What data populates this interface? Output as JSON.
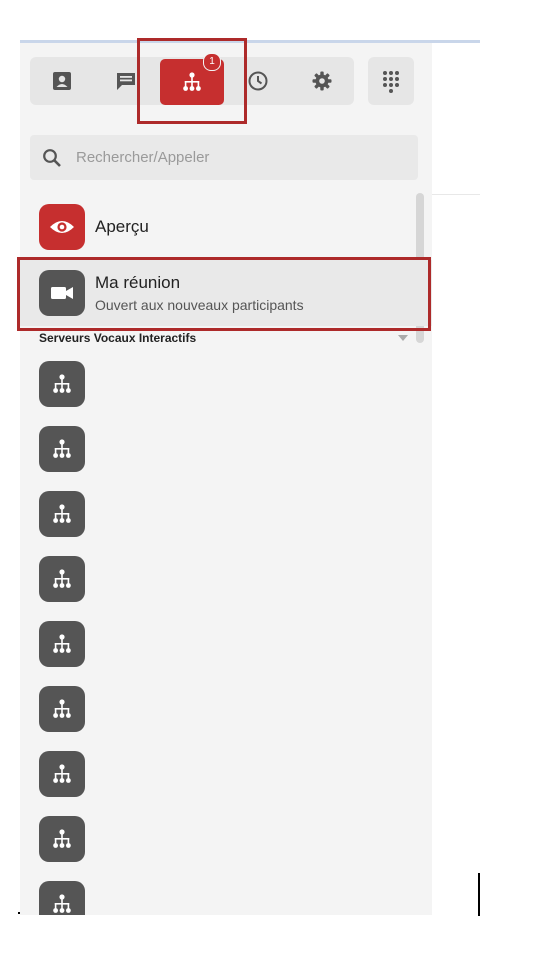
{
  "tabs": [
    {
      "name": "contacts",
      "icon": "contact-card-icon"
    },
    {
      "name": "chat",
      "icon": "chat-icon"
    },
    {
      "name": "ivr",
      "icon": "hierarchy-icon",
      "active": true,
      "badge": "1"
    },
    {
      "name": "history",
      "icon": "clock-icon"
    },
    {
      "name": "settings",
      "icon": "gear-icon"
    }
  ],
  "dialpad": {
    "icon": "dialpad-icon"
  },
  "search": {
    "placeholder": "Rechercher/Appeler"
  },
  "preview": {
    "title": "Aperçu",
    "icon": "eye-icon"
  },
  "meeting": {
    "title": "Ma réunion",
    "subtitle": "Ouvert aux nouveaux participants",
    "icon": "video-camera-icon"
  },
  "section": {
    "title": "Serveurs Vocaux Interactifs"
  },
  "ivr_items": 9,
  "colors": {
    "accent": "#c62f2f",
    "avatar_dark": "#555555",
    "panel": "#f4f4f4"
  }
}
